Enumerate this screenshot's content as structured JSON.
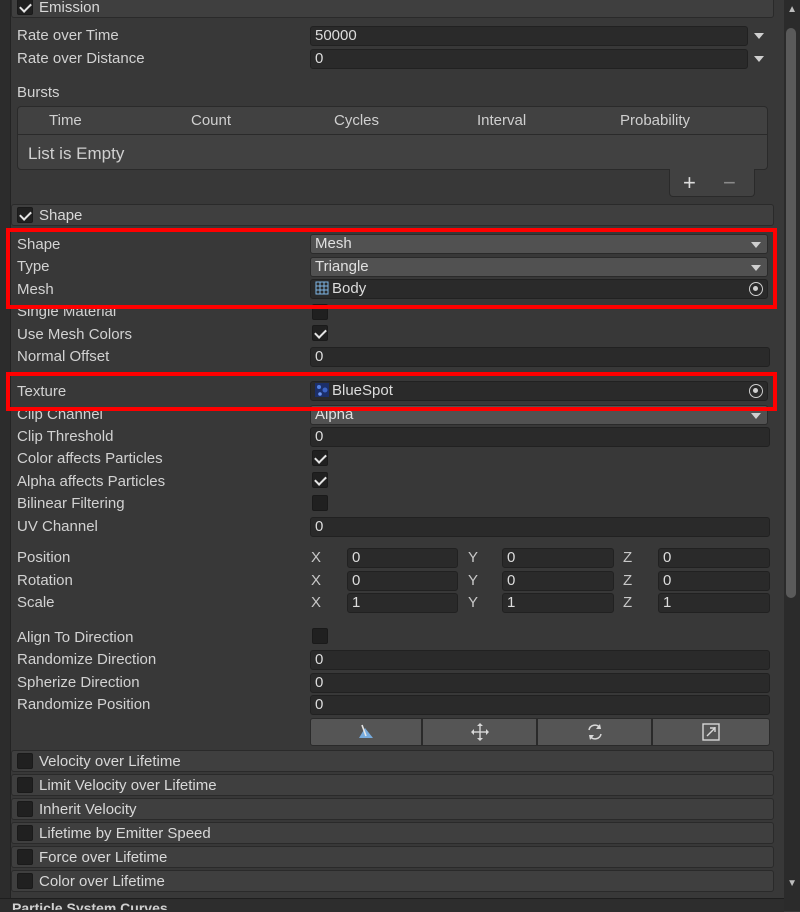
{
  "emission": {
    "title": "Emission",
    "enabled": true,
    "rate_over_time_label": "Rate over Time",
    "rate_over_time_value": "50000",
    "rate_over_distance_label": "Rate over Distance",
    "rate_over_distance_value": "0",
    "bursts_label": "Bursts",
    "bursts_columns": [
      "Time",
      "Count",
      "Cycles",
      "Interval",
      "Probability"
    ],
    "bursts_empty": "List is Empty",
    "add_symbol": "+",
    "remove_symbol": "−"
  },
  "shape_module": {
    "title": "Shape",
    "enabled": true,
    "shape_label": "Shape",
    "shape_value": "Mesh",
    "type_label": "Type",
    "type_value": "Triangle",
    "mesh_label": "Mesh",
    "mesh_value": "Body",
    "single_material_label": "Single Material",
    "single_material_checked": false,
    "use_mesh_colors_label": "Use Mesh Colors",
    "use_mesh_colors_checked": true,
    "normal_offset_label": "Normal Offset",
    "normal_offset_value": "0",
    "texture_label": "Texture",
    "texture_value": "BlueSpot",
    "clip_channel_label": "Clip Channel",
    "clip_channel_value": "Alpha",
    "clip_threshold_label": "Clip Threshold",
    "clip_threshold_value": "0",
    "color_affects_label": "Color affects Particles",
    "color_affects_checked": true,
    "alpha_affects_label": "Alpha affects Particles",
    "alpha_affects_checked": true,
    "bilinear_label": "Bilinear Filtering",
    "bilinear_checked": false,
    "uv_channel_label": "UV Channel",
    "uv_channel_value": "0",
    "position_label": "Position",
    "rotation_label": "Rotation",
    "scale_label": "Scale",
    "axis_x": "X",
    "axis_y": "Y",
    "axis_z": "Z",
    "position": {
      "x": "0",
      "y": "0",
      "z": "0"
    },
    "rotation": {
      "x": "0",
      "y": "0",
      "z": "0"
    },
    "scale": {
      "x": "1",
      "y": "1",
      "z": "1"
    },
    "align_label": "Align To Direction",
    "align_checked": false,
    "randomize_dir_label": "Randomize Direction",
    "randomize_dir_value": "0",
    "spherize_label": "Spherize Direction",
    "spherize_value": "0",
    "randomize_pos_label": "Randomize Position",
    "randomize_pos_value": "0",
    "toolbar_icons": [
      "edit-shape-icon",
      "move-icon",
      "rotate-icon",
      "scale-icon"
    ]
  },
  "modules": [
    {
      "title": "Velocity over Lifetime",
      "enabled": false
    },
    {
      "title": "Limit Velocity over Lifetime",
      "enabled": false
    },
    {
      "title": "Inherit Velocity",
      "enabled": false
    },
    {
      "title": "Lifetime by Emitter Speed",
      "enabled": false
    },
    {
      "title": "Force over Lifetime",
      "enabled": false
    },
    {
      "title": "Color over Lifetime",
      "enabled": false
    }
  ],
  "footer": {
    "title": "Particle System Curves"
  },
  "colors": {
    "highlight": "#ff0000",
    "panel": "#383838",
    "field": "#2a2a2a"
  }
}
